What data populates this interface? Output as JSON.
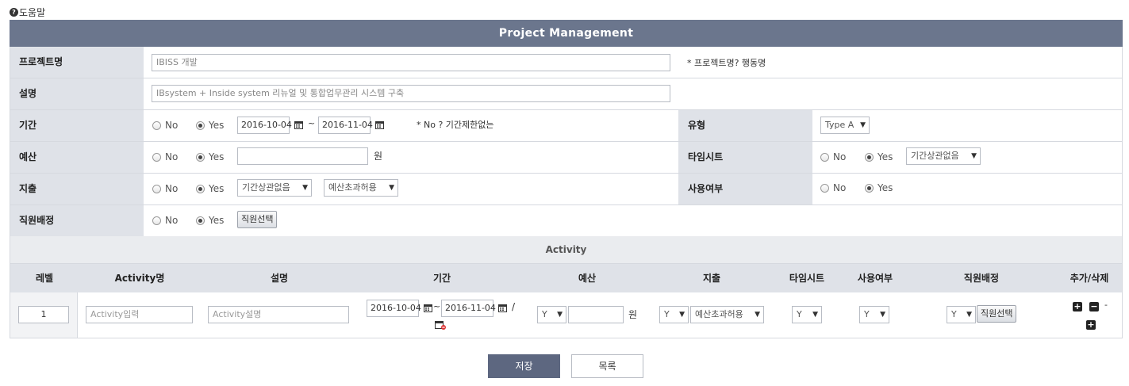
{
  "help": {
    "icon": "question-circle-icon",
    "label": "도움말"
  },
  "title": "Project Management",
  "form": {
    "project_name": {
      "label": "프로젝트명",
      "value": "IBISS 개발",
      "note": "* 프로젝트명? 행동명"
    },
    "description": {
      "label": "설명",
      "value": "IBsystem + Inside system 리뉴얼 및 통합업무관리 시스템 구축"
    },
    "period": {
      "label": "기간",
      "no": "No",
      "yes": "Yes",
      "start": "2016-10-04",
      "tilde": "~",
      "end": "2016-11-04",
      "note": "* No ? 기간제한없는"
    },
    "type": {
      "label": "유형",
      "value": "Type A"
    },
    "budget": {
      "label": "예산",
      "no": "No",
      "yes": "Yes",
      "value": "",
      "unit": "원"
    },
    "timesheet": {
      "label": "타임시트",
      "no": "No",
      "yes": "Yes",
      "value": "기간상관없음"
    },
    "expense": {
      "label": "지출",
      "no": "No",
      "yes": "Yes",
      "value1": "기간상관없음",
      "value2": "예산초과허용"
    },
    "usage": {
      "label": "사용여부",
      "no": "No",
      "yes": "Yes"
    },
    "staff": {
      "label": "직원배정",
      "no": "No",
      "yes": "Yes",
      "button": "직원선택"
    }
  },
  "activity": {
    "title": "Activity",
    "headers": [
      "레벨",
      "Activity명",
      "설명",
      "기간",
      "예산",
      "지출",
      "타임시트",
      "사용여부",
      "직원배정",
      "추가/삭제"
    ],
    "row": {
      "level": "1",
      "name_placeholder": "Activity입력",
      "desc_placeholder": "Activity설명",
      "start": "2016-10-04",
      "tilde": "~",
      "end": "2016-11-04",
      "slash": "/",
      "budget_select": "Y",
      "budget_unit": "원",
      "expense_select": "Y",
      "expense_value": "예산초과허용",
      "timesheet_select": "Y",
      "usage_select": "Y",
      "staff_select": "Y",
      "staff_button": "직원선택",
      "add": "+",
      "remove": "−",
      "dash": "-"
    }
  },
  "buttons": {
    "save": "저장",
    "list": "목록"
  },
  "colors": {
    "title_bg": "#6b768d",
    "label_bg": "#dfe2e8",
    "save_bg": "#5d6780"
  }
}
